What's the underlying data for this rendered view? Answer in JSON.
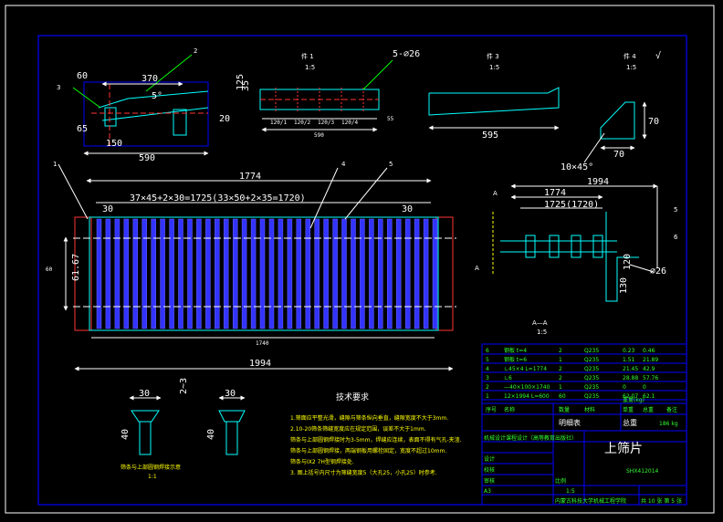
{
  "colors": {
    "background": "#000000",
    "frame": "#0000ff",
    "outline": "#00ffff",
    "bars": "#3333ff",
    "centerline": "#ff3333",
    "text": "#ffffff",
    "notes": "#ffff00",
    "table_text": "#33ff33"
  },
  "top_view": {
    "dim_370": "370",
    "dim_60": "60",
    "dim_5deg": "5°",
    "dim_20": "20",
    "dim_65": "65",
    "dim_150": "150",
    "dim_590": "590",
    "mark_3": "3",
    "mark_2": "2"
  },
  "section_view": {
    "title": "件 1",
    "scale": "1:5",
    "dim_125": "125",
    "dim_35": "35",
    "holes": "5-⌀26",
    "dim_55": "55",
    "dim_1": "120/1",
    "dim_2": "120/2",
    "dim_3": "120/3",
    "dim_4": "120/4",
    "dim_total": "590"
  },
  "part3_view": {
    "title": "件 3",
    "scale": "1:5",
    "dim_595": "595"
  },
  "part4_view": {
    "title": "件 4",
    "scale": "1:5",
    "dim_70h": "70",
    "dim_70w": "70",
    "chamfer": "10×45°"
  },
  "main_view": {
    "dim_1774": "1774",
    "dim_pitch": "37×45+2×30=1725(33×50+2×35=1720)",
    "dim_30l": "30",
    "dim_30r": "30",
    "dim_6167": "61.67",
    "dim_width_side": "60",
    "dim_bottom": "1994",
    "dim_inner": "1740",
    "mark_1": "1",
    "mark_4": "4",
    "mark_5": "5",
    "section_mark": "A"
  },
  "side_view": {
    "dim_1994": "1994",
    "dim_1774": "1774",
    "dim_1725": "1725(1720)",
    "dim_120": "120",
    "dim_130": "130",
    "dim_26": "⌀26",
    "section_label": "A—A",
    "section_scale": "1:5",
    "mark_5": "5",
    "mark_6": "6",
    "mark_a": "A"
  },
  "details": {
    "d1_30": "30",
    "d1_40": "40",
    "d1_23": "2~3",
    "d2_30": "30",
    "d2_40": "40",
    "caption": "筛条与上部圆钢焊接示意",
    "caption_scale": "1:1"
  },
  "notes": {
    "title": "技术要求",
    "lines": [
      "1.筛面应平整光滑，缝隙与筛条纵向垂直，缝隙宽度不大于3mm.",
      "2.10-20筛条筛缝宽度应在规定范围，误差不大于1mm.",
      "筛条与上部圆钢焊接时为3-5mm，焊缝应连续，表面不得有气孔-夹渣.",
      "筛条与上部圆钢焊接，两端钢板用螺栓固定，宽度不超过10mm.",
      "筛条与IX2 7H型钢焊接处.",
      "3.  图上括号内尺寸为筛缝宽度5（大孔25，小孔25）时参考."
    ]
  },
  "parts_table": {
    "rows": [
      [
        "6",
        "钢板 t=4",
        "2",
        "Q235",
        "0.23",
        "0.46"
      ],
      [
        "5",
        "钢板 t=6",
        "1",
        "Q235",
        "1.51",
        "21.89"
      ],
      [
        "4",
        "∟45×4 L=1774",
        "2",
        "Q235",
        "21.45",
        "42.9"
      ],
      [
        "3",
        "∟6",
        "2",
        "Q235",
        "28.88",
        "57.76"
      ],
      [
        "2",
        "—40×100×1740",
        "1",
        "Q235",
        "0",
        "0"
      ],
      [
        "1",
        "12×1994 L=600",
        "60",
        "Q235",
        "62.07",
        "62.1"
      ]
    ],
    "header": [
      "序号",
      "名称",
      "数量",
      "材料",
      "单重",
      "总重"
    ],
    "header_weight": "重量(kg)",
    "header_note": "备注",
    "list_title": "明细表",
    "total_label": "总重",
    "total_value": "186 kg"
  },
  "title_block": {
    "product_name": "上筛片",
    "drawing_no": "SHX412014",
    "school": "内蒙古科技大学机械工程学院",
    "designer_label": "设计",
    "checker_label": "校核",
    "approver_label": "审核",
    "scale_label": "比例",
    "scale_value": "1:5",
    "sheet": "共 10 张 第 5 张",
    "course": "机械设计课程设计（高等教育出版社）",
    "grade": "A3"
  }
}
